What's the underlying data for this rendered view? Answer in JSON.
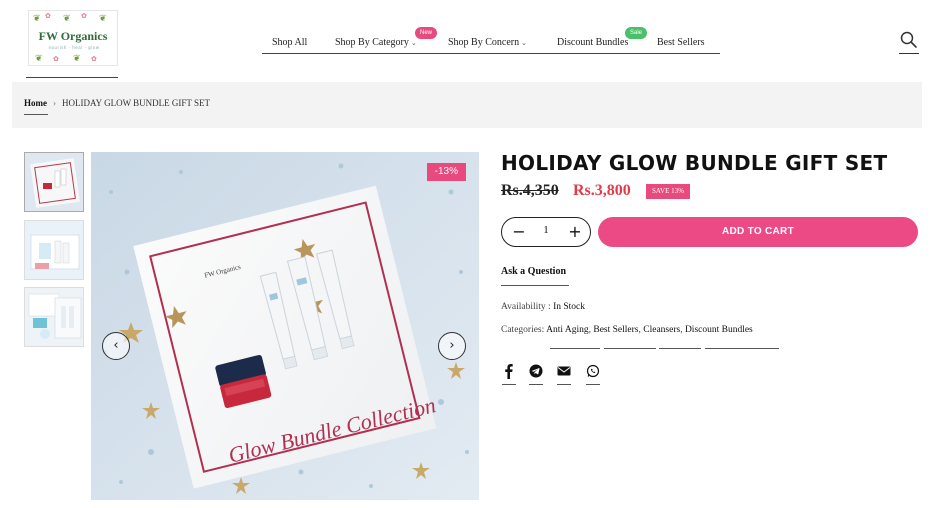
{
  "header": {
    "logo": {
      "title": "FW Organics",
      "tagline": "nourish · heal · glow"
    },
    "nav": [
      {
        "label": "Shop All"
      },
      {
        "label": "Shop By Category",
        "badge": "New"
      },
      {
        "label": "Shop By Concern"
      },
      {
        "label": "Discount Bundles",
        "badge": "Sale"
      },
      {
        "label": "Best Sellers"
      }
    ],
    "search_icon": "search-icon"
  },
  "breadcrumb": {
    "home": "Home",
    "current": "HOLIDAY GLOW BUNDLE GIFT SET"
  },
  "gallery": {
    "thumbnails": 3,
    "discount_tag": "-13%",
    "box_text": "Glow Bundle Collection",
    "box_brand": "FW Organics"
  },
  "product": {
    "title": "HOLIDAY GLOW BUNDLE GIFT SET",
    "old_price": "Rs.4,350",
    "new_price": "Rs.3,800",
    "save_badge": "SAVE 13%",
    "quantity": "1",
    "add_to_cart": "ADD TO CART",
    "ask_question": "Ask a Question",
    "availability_label": "Availability :",
    "availability_value": "In Stock",
    "categories_label": "Categories:",
    "categories": [
      "Anti Aging",
      "Best Sellers",
      "Cleansers",
      "Discount Bundles"
    ],
    "share_icons": [
      "facebook-icon",
      "telegram-icon",
      "email-icon",
      "whatsapp-icon"
    ]
  },
  "colors": {
    "accent": "#ec4a84",
    "price_red": "#e03b4b",
    "badge_sale": "#4bc06a"
  }
}
